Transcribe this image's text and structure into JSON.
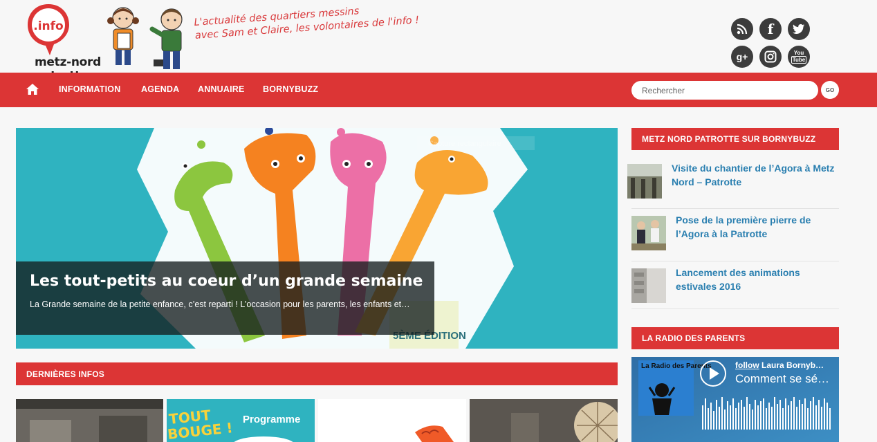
{
  "header": {
    "logo_badge": ".info",
    "logo_text": "metz-nord patrotte",
    "tagline_line1": "L'actualité des quartiers messins",
    "tagline_line2": "avec Sam et Claire, les volontaires de l'info !",
    "social_icons": [
      "rss-icon",
      "facebook-icon",
      "twitter-icon",
      "googleplus-icon",
      "instagram-icon",
      "youtube-icon"
    ]
  },
  "nav": {
    "home_icon": "home-icon",
    "items": [
      "INFORMATION",
      "AGENDA",
      "ANNUAIRE",
      "BORNYBUZZ"
    ],
    "search_placeholder": "Rechercher",
    "search_button": "GO"
  },
  "hero": {
    "title": "Les tout-petits au coeur d’un grande semaine",
    "excerpt": "La Grande semaine de la petite enfance, c’est reparti ! L’occasion pour les parents, les enfants et…",
    "edition_label": "5ÈME ÉDITION",
    "ghost_text": "Capture rectangulaire"
  },
  "latest": {
    "title": "DERNIÈRES INFOS",
    "thumb2_text1": "TOUT",
    "thumb2_text2": "BOUGE !",
    "thumb2_side": "Programme"
  },
  "sidebar": {
    "bornybuzz_title": "METZ NORD PATROTTE SUR BORNYBUZZ",
    "posts": [
      {
        "title": "Visite du chantier de l’Agora à Metz Nord – Patrotte"
      },
      {
        "title": "Pose de la première pierre de l’Agora à la Patrotte"
      },
      {
        "title": "Lancement des animations estivales 2016"
      }
    ],
    "radio_title": "LA RADIO DES PARENTS",
    "radio": {
      "cover_title": "La Radio des Parents",
      "follow": "follow",
      "author": "Laura Bornyb…",
      "track": "Comment se sé…"
    }
  },
  "colors": {
    "brand_red": "#dc3535",
    "teal": "#2fb3c0",
    "link_blue": "#2a7fb0"
  }
}
